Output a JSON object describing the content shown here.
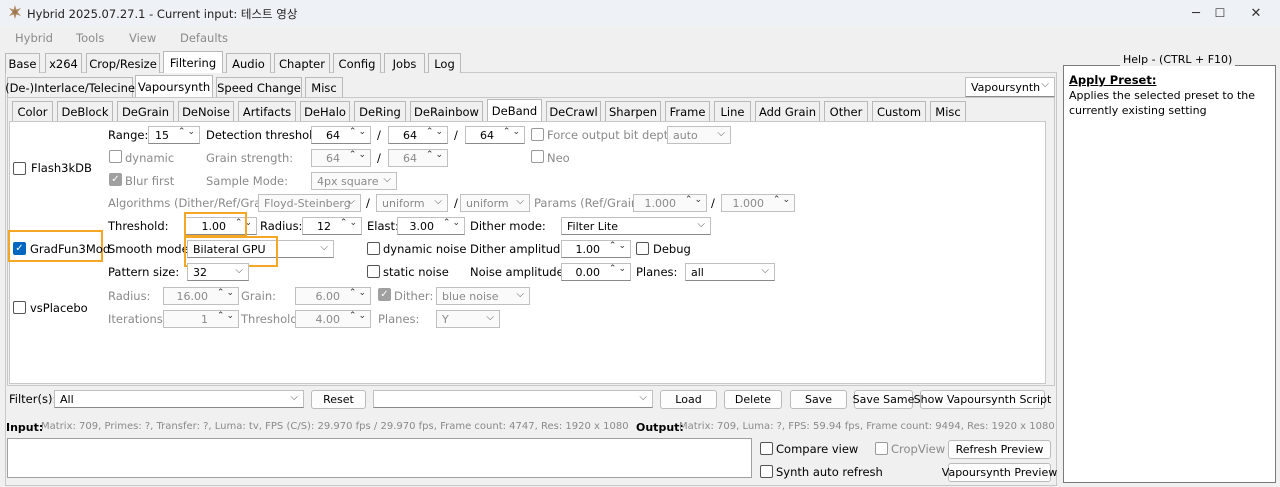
{
  "window": {
    "title": "Hybrid 2025.07.27.1 - Current input: 테스트 영상",
    "minimize": "─",
    "maximize": "☐",
    "close": "✕"
  },
  "menu": [
    "Hybrid",
    "Tools",
    "View",
    "Defaults"
  ],
  "main_tabs": [
    "Base",
    "x264",
    "Crop/Resize",
    "Filtering",
    "Audio",
    "Chapter",
    "Config",
    "Jobs",
    "Log"
  ],
  "filter_tabs": [
    "(De-)Interlace/Telecine",
    "Vapoursynth",
    "Speed Change",
    "Misc"
  ],
  "filter_engine": "Vapoursynth",
  "sub_tabs": [
    "Color",
    "DeBlock",
    "DeGrain",
    "DeNoise",
    "Artifacts",
    "DeHalo",
    "DeRing",
    "DeRainbow",
    "DeBand",
    "DeCrawl",
    "Sharpen",
    "Frame",
    "Line",
    "Add Grain",
    "Other",
    "Custom",
    "Misc"
  ],
  "f3k": {
    "name": "Flash3kDB",
    "range_label": "Range:",
    "range": "15",
    "det_label": "Detection threshold:",
    "det1": "64",
    "det2": "64",
    "det3": "64",
    "force_label": "Force output bit depth",
    "force_value": "auto",
    "dynamic_label": "dynamic",
    "grain_label": "Grain strength:",
    "grain1": "64",
    "grain2": "64",
    "neo_label": "Neo",
    "blur_label": "Blur first",
    "sample_label": "Sample Mode:",
    "sample_value": "4px square",
    "alg_label": "Algorithms (Dither/Ref/Grain):",
    "alg1": "Floyd-Steinberg",
    "alg2": "uniform",
    "alg3": "uniform",
    "params_label": "Params (Ref/Grain):",
    "param1": "1.000",
    "param2": "1.000",
    "sep": "/"
  },
  "gradfun": {
    "name": "GradFun3Mod",
    "threshold_label": "Threshold:",
    "threshold": "1.00",
    "radius_label": "Radius:",
    "radius": "12",
    "elast_label": "Elast:",
    "elast": "3.00",
    "dither_mode_label": "Dither mode:",
    "dither_mode": "Filter Lite",
    "smooth_label": "Smooth mode:",
    "smooth": "Bilateral GPU",
    "dyn_noise_label": "dynamic noise",
    "dither_amp_label": "Dither amplitude:",
    "dither_amp": "1.00",
    "debug_label": "Debug",
    "pattern_label": "Pattern size:",
    "pattern": "32",
    "static_noise_label": "static noise",
    "noise_amp_label": "Noise amplitude:",
    "noise_amp": "0.00",
    "planes_label": "Planes:",
    "planes": "all"
  },
  "placebo": {
    "name": "vsPlacebo",
    "radius_label": "Radius:",
    "radius": "16.00",
    "grain_label": "Grain:",
    "grain": "6.00",
    "dither_label": "Dither:",
    "dither": "blue noise",
    "iter_label": "Iterations:",
    "iterations": "1",
    "threshold_label": "Threshold:",
    "threshold": "4.00",
    "planes_label": "Planes:",
    "planes": "Y"
  },
  "filters_bar": {
    "label": "Filter(s):",
    "value": "All",
    "reset": "Reset",
    "load": "Load",
    "delete": "Delete",
    "save": "Save",
    "save_same": "Save Same",
    "show_script": "Show Vapoursynth Script"
  },
  "info": {
    "input_label": "Input:",
    "input_value": "Matrix: 709, Primes: ?, Transfer: ?, Luma: tv, FPS (C/S): 29.970 fps / 29.970 fps, Frame count: 4747, Res: 1920 x 1080",
    "output_label": "Output:",
    "output_value": "Matrix: 709, Luma: ?, FPS: 59.94 fps, Frame count: 9494, Res: 1920 x 1080"
  },
  "bottom": {
    "compare_view": "Compare view",
    "crop_view": "CropView",
    "refresh_preview": "Refresh Preview",
    "synth_auto": "Synth auto refresh",
    "vs_preview": "Vapoursynth Preview"
  },
  "help": {
    "title": "Help - (CTRL + F10)",
    "heading": "Apply Preset:",
    "body": "Applies the selected preset to the currently existing setting"
  },
  "colors": {
    "accent": "#0067c0",
    "highlight": "#f5a623"
  }
}
